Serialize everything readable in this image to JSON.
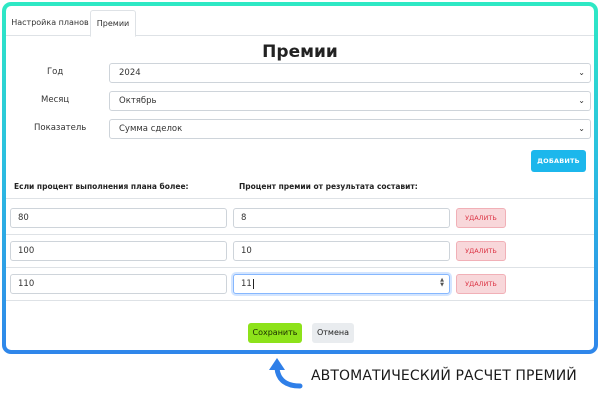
{
  "tabs": [
    {
      "label": "Настройка планов"
    },
    {
      "label": "Премии"
    }
  ],
  "page_title": "Премии",
  "form": {
    "year": {
      "label": "Год",
      "value": "2024"
    },
    "month": {
      "label": "Месяц",
      "value": "Октябрь"
    },
    "metric": {
      "label": "Показатель",
      "value": "Сумма сделок"
    }
  },
  "add_button": "ДОБАВИТЬ",
  "columns": {
    "threshold": "Если процент выполнения плана более:",
    "bonus": "Процент премии от результата составит:"
  },
  "rows": [
    {
      "threshold": "80",
      "bonus": "8",
      "delete_label": "УДАЛИТЬ"
    },
    {
      "threshold": "100",
      "bonus": "10",
      "delete_label": "УДАЛИТЬ"
    },
    {
      "threshold": "110",
      "bonus": "11",
      "delete_label": "УДАЛИТЬ"
    }
  ],
  "footer": {
    "save": "Сохранить",
    "cancel": "Отмена"
  },
  "caption": "АВТОМАТИЧЕСКИЙ РАСЧЕТ ПРЕМИЙ",
  "colors": {
    "frame_gradient_top": "#2ee9c4",
    "frame_gradient_bottom": "#2f86ea",
    "add_button": "#1cb7ec",
    "save_button": "#8de21a",
    "delete_button_bg": "#f8d7da",
    "delete_button_text": "#dc3545",
    "caption_arrow": "#2f7fe8"
  },
  "icons": {
    "select_chevron": "chevron-down-icon",
    "number_spinner": "spinner-arrows-icon",
    "caption_arrow": "curved-up-arrow-icon"
  }
}
